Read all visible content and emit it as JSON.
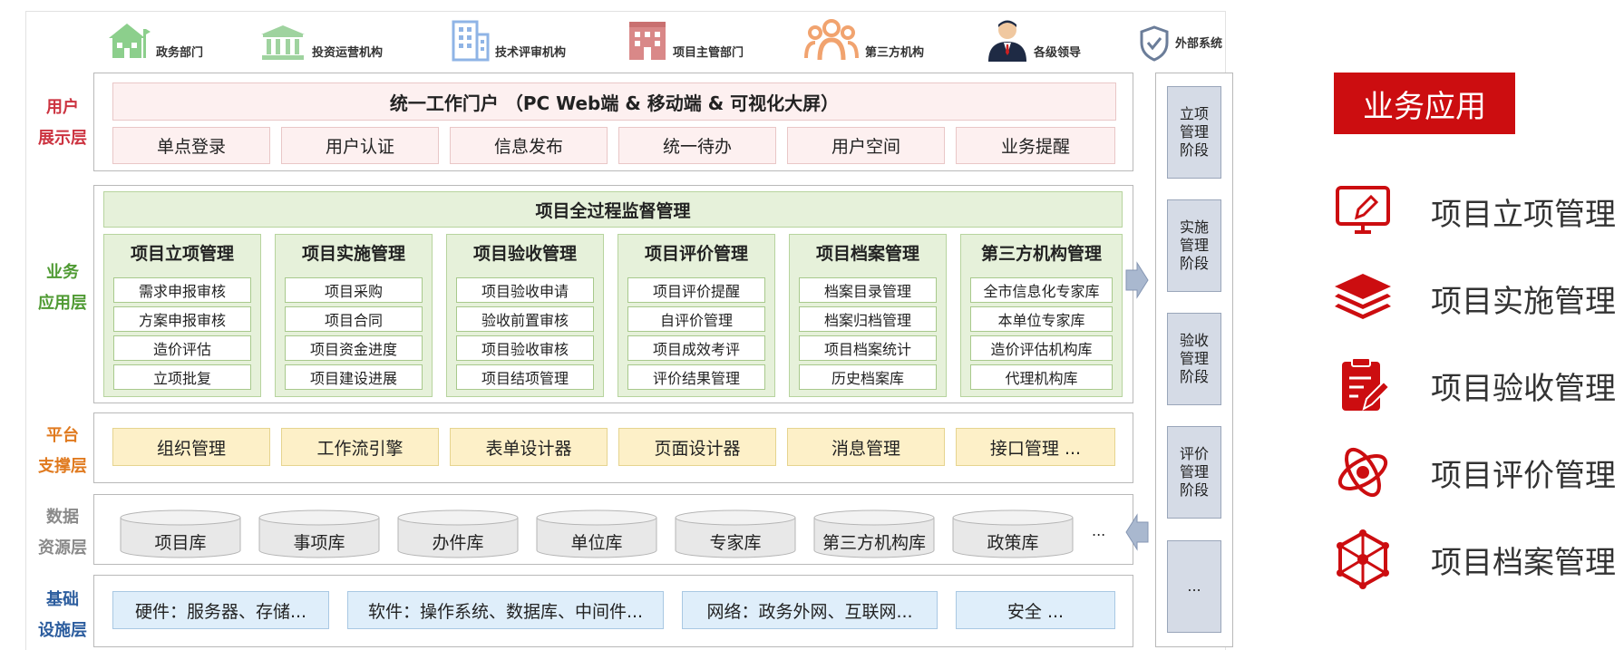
{
  "users": [
    {
      "label": "政务部门",
      "icon": "government-building-icon",
      "color": "#8ccf8c"
    },
    {
      "label": "投资运营机构",
      "icon": "bank-icon",
      "color": "#9fd39f"
    },
    {
      "label": "技术评审机构",
      "icon": "office-tower-icon",
      "color": "#8fb4e6"
    },
    {
      "label": "项目主管部门",
      "icon": "building-icon",
      "color": "#d98888"
    },
    {
      "label": "第三方机构",
      "icon": "people-group-icon",
      "color": "#f1a36f"
    },
    {
      "label": "各级领导",
      "icon": "leader-avatar-icon",
      "color": "#1e2a44"
    },
    {
      "label": "外部系统",
      "icon": "shield-check-icon",
      "color": "#6b7d99"
    }
  ],
  "layers": {
    "user": {
      "label_line1": "用户",
      "label_line2": "展示层",
      "color": "#cc3340"
    },
    "business": {
      "label_line1": "业务",
      "label_line2": "应用层",
      "color": "#4f9a33"
    },
    "platform": {
      "label_line1": "平台",
      "label_line2": "支撑层",
      "color": "#e07a1f"
    },
    "data": {
      "label_line1": "数据",
      "label_line2": "资源层",
      "color": "#8a8a8a"
    },
    "infra": {
      "label_line1": "基础",
      "label_line2": "设施层",
      "color": "#2c5d9e"
    }
  },
  "user_layer": {
    "portal": "统一工作门户 （PC Web端 & 移动端 & 可视化大屏）",
    "items": [
      "单点登录",
      "用户认证",
      "信息发布",
      "统一待办",
      "用户空间",
      "业务提醒"
    ]
  },
  "business_layer": {
    "title": "项目全过程监督管理",
    "columns": [
      {
        "title": "项目立项管理",
        "items": [
          "需求申报审核",
          "方案申报审核",
          "造价评估",
          "立项批复"
        ]
      },
      {
        "title": "项目实施管理",
        "items": [
          "项目采购",
          "项目合同",
          "项目资金进度",
          "项目建设进展"
        ]
      },
      {
        "title": "项目验收管理",
        "items": [
          "项目验收申请",
          "验收前置审核",
          "项目验收审核",
          "项目结项管理"
        ]
      },
      {
        "title": "项目评价管理",
        "items": [
          "项目评价提醒",
          "自评价管理",
          "项目成效考评",
          "评价结果管理"
        ]
      },
      {
        "title": "项目档案管理",
        "items": [
          "档案目录管理",
          "档案归档管理",
          "项目档案统计",
          "历史档案库"
        ]
      },
      {
        "title": "第三方机构管理",
        "items": [
          "全市信息化专家库",
          "本单位专家库",
          "造价评估机构库",
          "代理机构库"
        ]
      }
    ]
  },
  "platform_layer": {
    "items": [
      "组织管理",
      "工作流引擎",
      "表单设计器",
      "页面设计器",
      "消息管理",
      "接口管理 ..."
    ]
  },
  "data_layer": {
    "items": [
      "项目库",
      "事项库",
      "办件库",
      "单位库",
      "专家库",
      "第三方机构库",
      "政策库"
    ],
    "more": "..."
  },
  "infra_layer": {
    "items": [
      "硬件：服务器、存储...",
      "软件：操作系统、数据库、中间件...",
      "网络：政务外网、互联网...",
      "安全 ..."
    ]
  },
  "stages": [
    "立项\n管理\n阶段",
    "实施\n管理\n阶段",
    "验收\n管理\n阶段",
    "评价\n管理\n阶段",
    "..."
  ],
  "legend": {
    "title": "业务应用",
    "accent": "#cc0d10",
    "items": [
      {
        "label": "项目立项管理",
        "icon": "monitor-pen-icon"
      },
      {
        "label": "项目实施管理",
        "icon": "layers-icon"
      },
      {
        "label": "项目验收管理",
        "icon": "clipboard-edit-icon"
      },
      {
        "label": "项目评价管理",
        "icon": "orbit-eye-icon"
      },
      {
        "label": "项目档案管理",
        "icon": "hexagon-network-icon"
      }
    ]
  }
}
